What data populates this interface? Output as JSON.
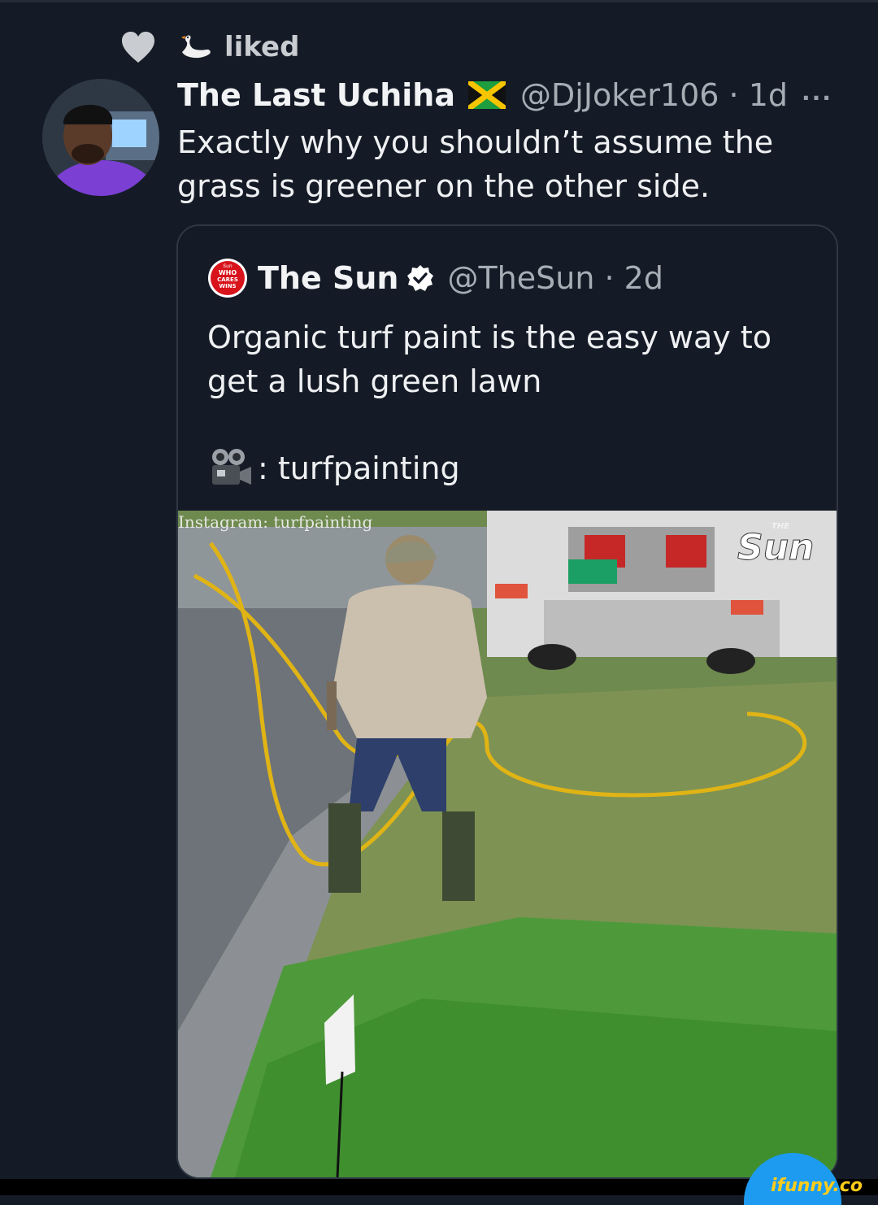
{
  "activity": {
    "label": "liked"
  },
  "tweet": {
    "display_name": "The Last Uchiha",
    "handle_time": "@DjJoker106 · 1d",
    "text": "Exactly why you shouldn’t assume the grass is greener on the other side.",
    "more": "···"
  },
  "quoted": {
    "display_name": "The Sun",
    "handle_time": "@TheSun · 2d",
    "text": "Organic turf paint is the easy way to get a lush green lawn",
    "credit": ": turfpainting",
    "logo_text": [
      "Sun",
      "WHO",
      "CARES",
      "WINS"
    ],
    "media": {
      "watermark": "Instagram: turfpainting",
      "brand_overlay": [
        "THE",
        "Sun"
      ]
    }
  },
  "watermark": {
    "ifunny": "ifunny.co"
  },
  "colors": {
    "background": "#151b26",
    "text": "#eef0f2",
    "muted": "#a7adb5",
    "verified": "#ffffff",
    "sun_red": "#d8131b",
    "ifunny_yellow": "#ffcc1a"
  }
}
